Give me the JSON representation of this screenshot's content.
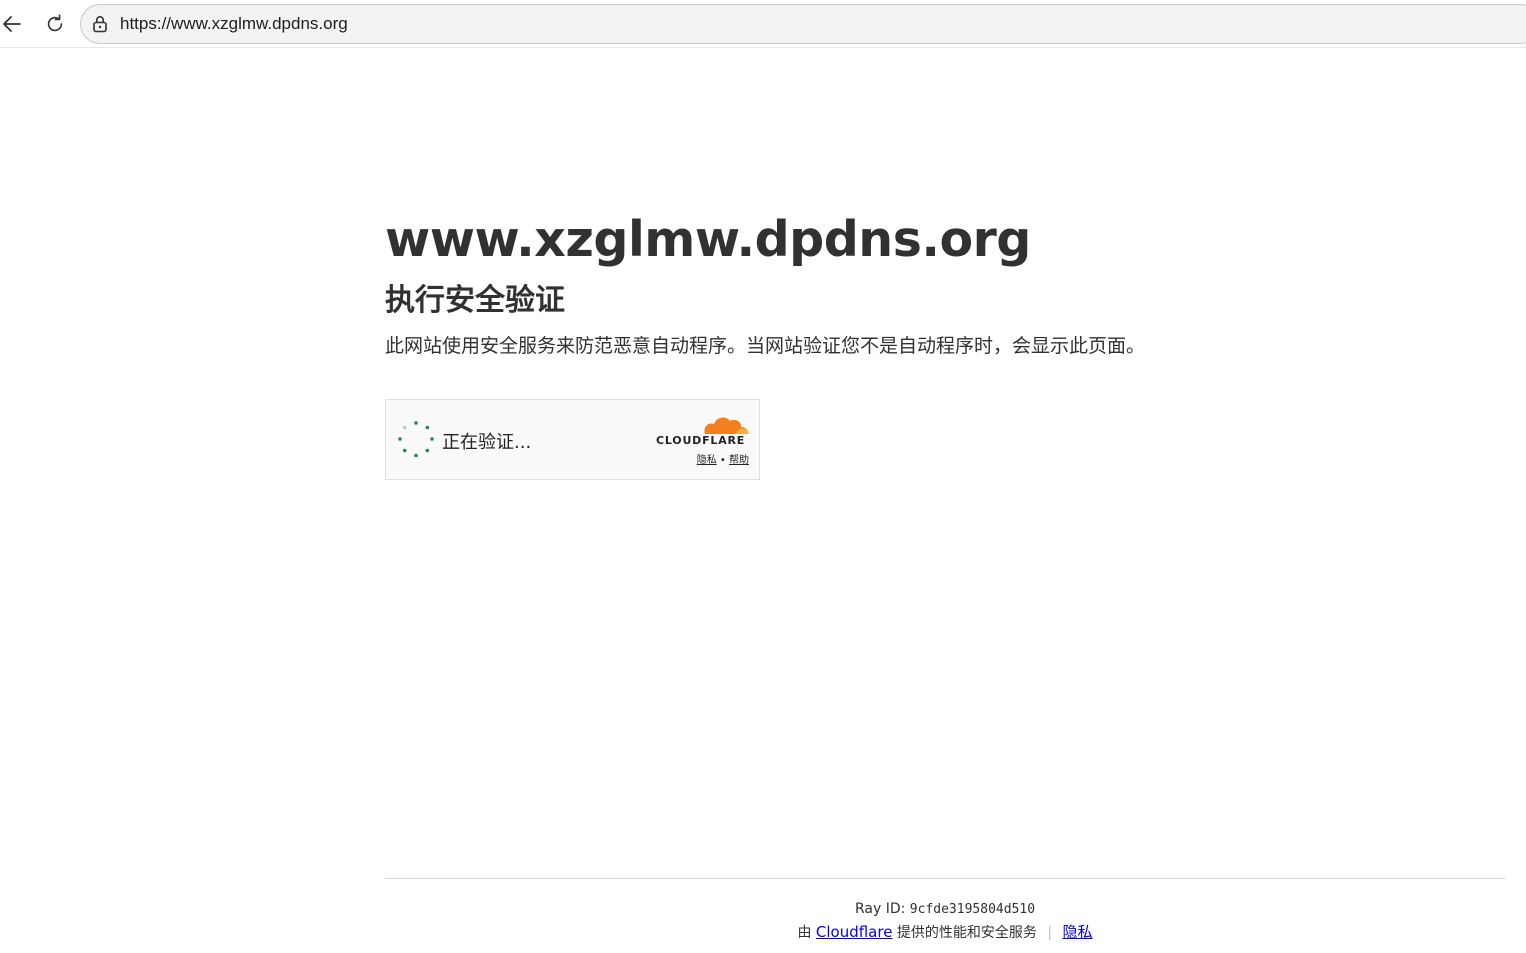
{
  "browser": {
    "url": "https://www.xzglmw.dpdns.org",
    "icons": {
      "back": "back-arrow-icon",
      "reload": "reload-icon",
      "lock": "lock-icon"
    }
  },
  "main": {
    "site_title": "www.xzglmw.dpdns.org",
    "subtitle": "执行安全验证",
    "description": "此网站使用安全服务来防范恶意自动程序。当网站验证您不是自动程序时，会显示此页面。"
  },
  "widget": {
    "status_text": "正在验证...",
    "brand": "CLOUDFLARE",
    "privacy_link": "隐私",
    "dot": "•",
    "help_link": "帮助",
    "colors": {
      "spinner": "#1e8a4c",
      "cloud_primary": "#f38020",
      "cloud_secondary": "#faae40"
    }
  },
  "footer": {
    "ray_label": "Ray ID:",
    "ray_id": "9cfde3195804d510",
    "by_prefix": "由",
    "cloudflare_link": "Cloudflare",
    "provided_text": "提供的性能和安全服务",
    "separator": "|",
    "privacy_link": "隐私"
  }
}
